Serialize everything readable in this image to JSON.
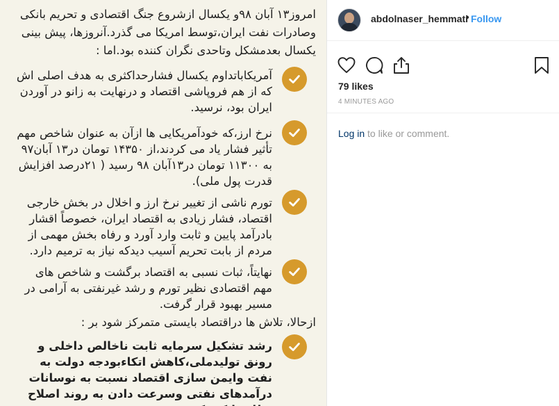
{
  "post_image": {
    "intro": "امروز۱۳ آبان ۹۸و یکسال ازشروع جنگ اقتصادی و تحریم بانکی وصادرات نفت ایران،توسط امریکا می گذرد.آنروزها، پیش بینی یکسال بعدمشکل وتاحدی نگران کننده بود.اما :",
    "items": [
      "آمریکاباتداوم یکسال فشارحداکثری به هدف اصلی اش که از هم فروپاشی اقتصاد و درنهایت به زانو در آوردن ایران بود، نرسید.",
      "نرخ ارز،که خودآمریکایی ها ازآن به عنوان شاخص مهم تأثیر فشار یاد می کردند،از ۱۴۳۵۰ تومان در۱۳ آبان۹۷ به ۱۱۳۰۰ تومان در۱۳آبان ۹۸ رسید ( ۲۱درصد افزایش قدرت پول ملی).",
      "تورم ناشی از تغییر نرخ ارز و اخلال در بخش خارجی اقتصاد، فشار زیادی به اقتصاد ایران، خصوصاً اقشار بادرآمد پایین و ثابت وارد آورد و رفاه بخش مهمی از مردم از بابت تحریم آسیب دیدکه نیاز به ترمیم دارد.",
      "نهایتاً، ثبات نسبی به اقتصاد برگشت و شاخص های مهم اقتصادی نظیر تورم و رشد غیرنفتی به آرامی در مسیر بهبود قرار گرفت."
    ],
    "lead": "ازحالا، تلاش ها دراقتصاد بایستی متمرکز شود بر :",
    "final_item": "رشد تشکیل سرمایه ثابت ناخالص داخلی و رونق تولیدملی،کاهش اتکاءبودجه دولت به نفت وایمن سازی اقتصاد نسبت به نوسانات درآمدهای نفتی وسرعت دادن به روند اصلاح  نظام بانکی کشور.",
    "check_color": "#d69a2c"
  },
  "header": {
    "username": "abdolnaser_hemmati",
    "separator": "•",
    "follow_label": "Follow"
  },
  "actions": {
    "icons": [
      "heart-icon",
      "comment-icon",
      "share-icon",
      "bookmark-icon"
    ]
  },
  "likes": "79 likes",
  "timestamp": "4 MINUTES AGO",
  "comment_prompt": {
    "link": "Log in",
    "rest": " to like or comment."
  },
  "colors": {
    "link_blue": "#3897f0",
    "login_link": "#003569",
    "muted": "#999999"
  }
}
